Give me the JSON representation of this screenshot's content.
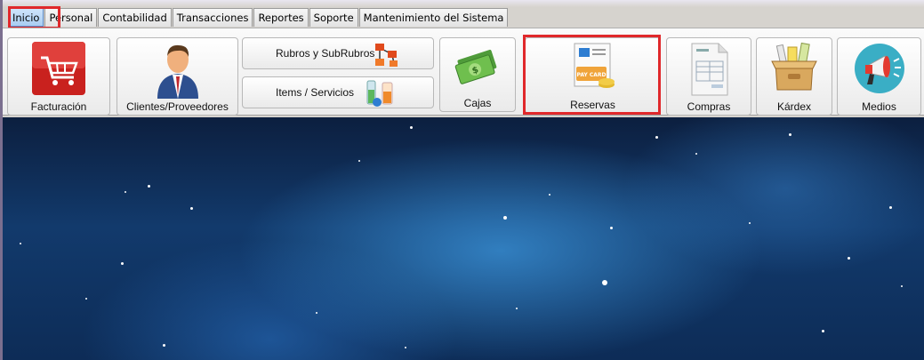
{
  "tabs": [
    "Inicio",
    "Personal",
    "Contabilidad",
    "Transacciones",
    "Reportes",
    "Soporte",
    "Mantenimiento del Sistema"
  ],
  "active_tab": "Inicio",
  "ribbon": {
    "facturacion": "Facturación",
    "clientes": "Clientes/Proveedores",
    "rubros": "Rubros y SubRubros",
    "items": "Items / Servicios",
    "cajas": "Cajas",
    "reservas": "Reservas",
    "compras": "Compras",
    "kardex": "Kárdex",
    "medios": "Medios"
  },
  "icons": {
    "facturacion": "shopping-cart-icon",
    "clientes": "businessman-icon",
    "rubros": "hierarchy-icon",
    "items": "flasks-icon",
    "cajas": "money-icon",
    "reservas": "pay-card-icon",
    "compras": "invoice-document-icon",
    "kardex": "box-icon",
    "medios": "megaphone-icon"
  },
  "pay_card_text": "PAY CARD",
  "highlight_color": "#e0282b"
}
